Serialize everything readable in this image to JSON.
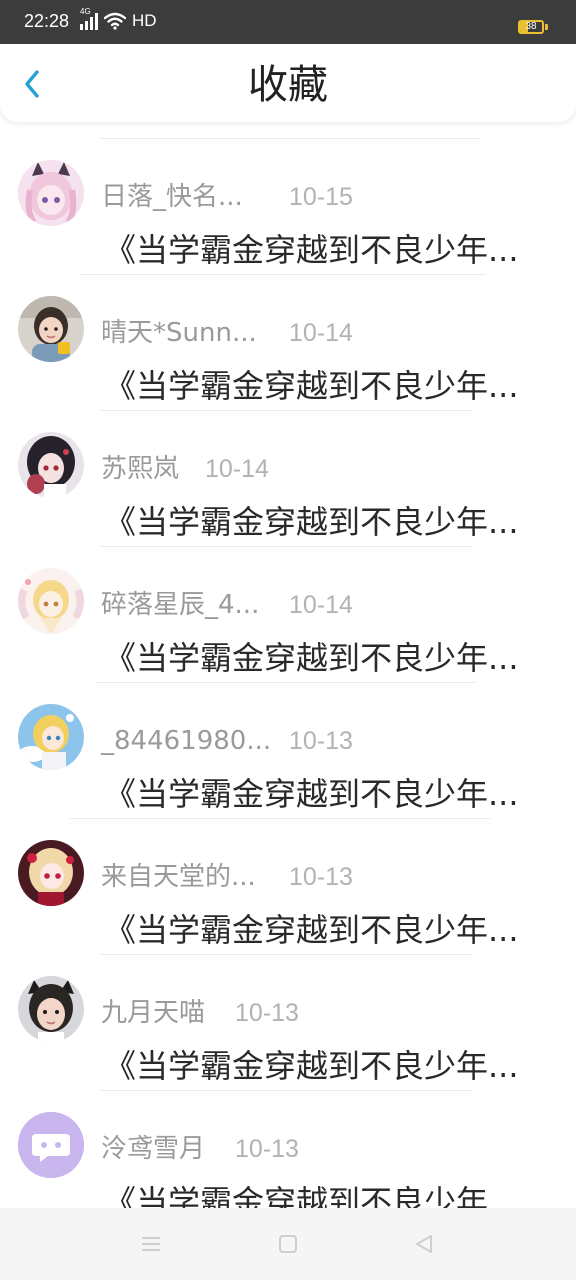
{
  "status_bar": {
    "time": "22:28",
    "network": "4G",
    "hd": "HD",
    "battery": "38"
  },
  "header": {
    "title": "收藏"
  },
  "items": [
    {
      "name": "日落_快名...",
      "date": "10-15",
      "text": "《当学霸金穿越到不良少年..."
    },
    {
      "name": "晴天*Sunn...",
      "date": "10-14",
      "text": "《当学霸金穿越到不良少年..."
    },
    {
      "name": "苏熙岚",
      "date": "10-14",
      "text": "《当学霸金穿越到不良少年..."
    },
    {
      "name": "碎落星辰_4...",
      "date": "10-14",
      "text": "《当学霸金穿越到不良少年..."
    },
    {
      "name": "_84461980...",
      "date": "10-13",
      "text": "《当学霸金穿越到不良少年..."
    },
    {
      "name": "来自天堂的...",
      "date": "10-13",
      "text": "《当学霸金穿越到不良少年..."
    },
    {
      "name": "九月天喵",
      "date": "10-13",
      "text": "《当学霸金穿越到不良少年..."
    },
    {
      "name": "泠鸢雪月",
      "date": "10-13",
      "text": "《当学霸金穿越到不良少年..."
    }
  ],
  "colors": {
    "accent": "#2a9fd6",
    "status_bar": "#3c3c3c",
    "battery": "#e8c030",
    "name_text": "#9a9a9a",
    "date_text": "#b2b2b2",
    "body_text": "#2a2a2a",
    "default_avatar": "#c9b6ee"
  },
  "icons": {
    "back": "chevron-left-icon",
    "nav_menu": "menu-icon",
    "nav_home": "square-icon",
    "nav_back": "triangle-back-icon"
  }
}
